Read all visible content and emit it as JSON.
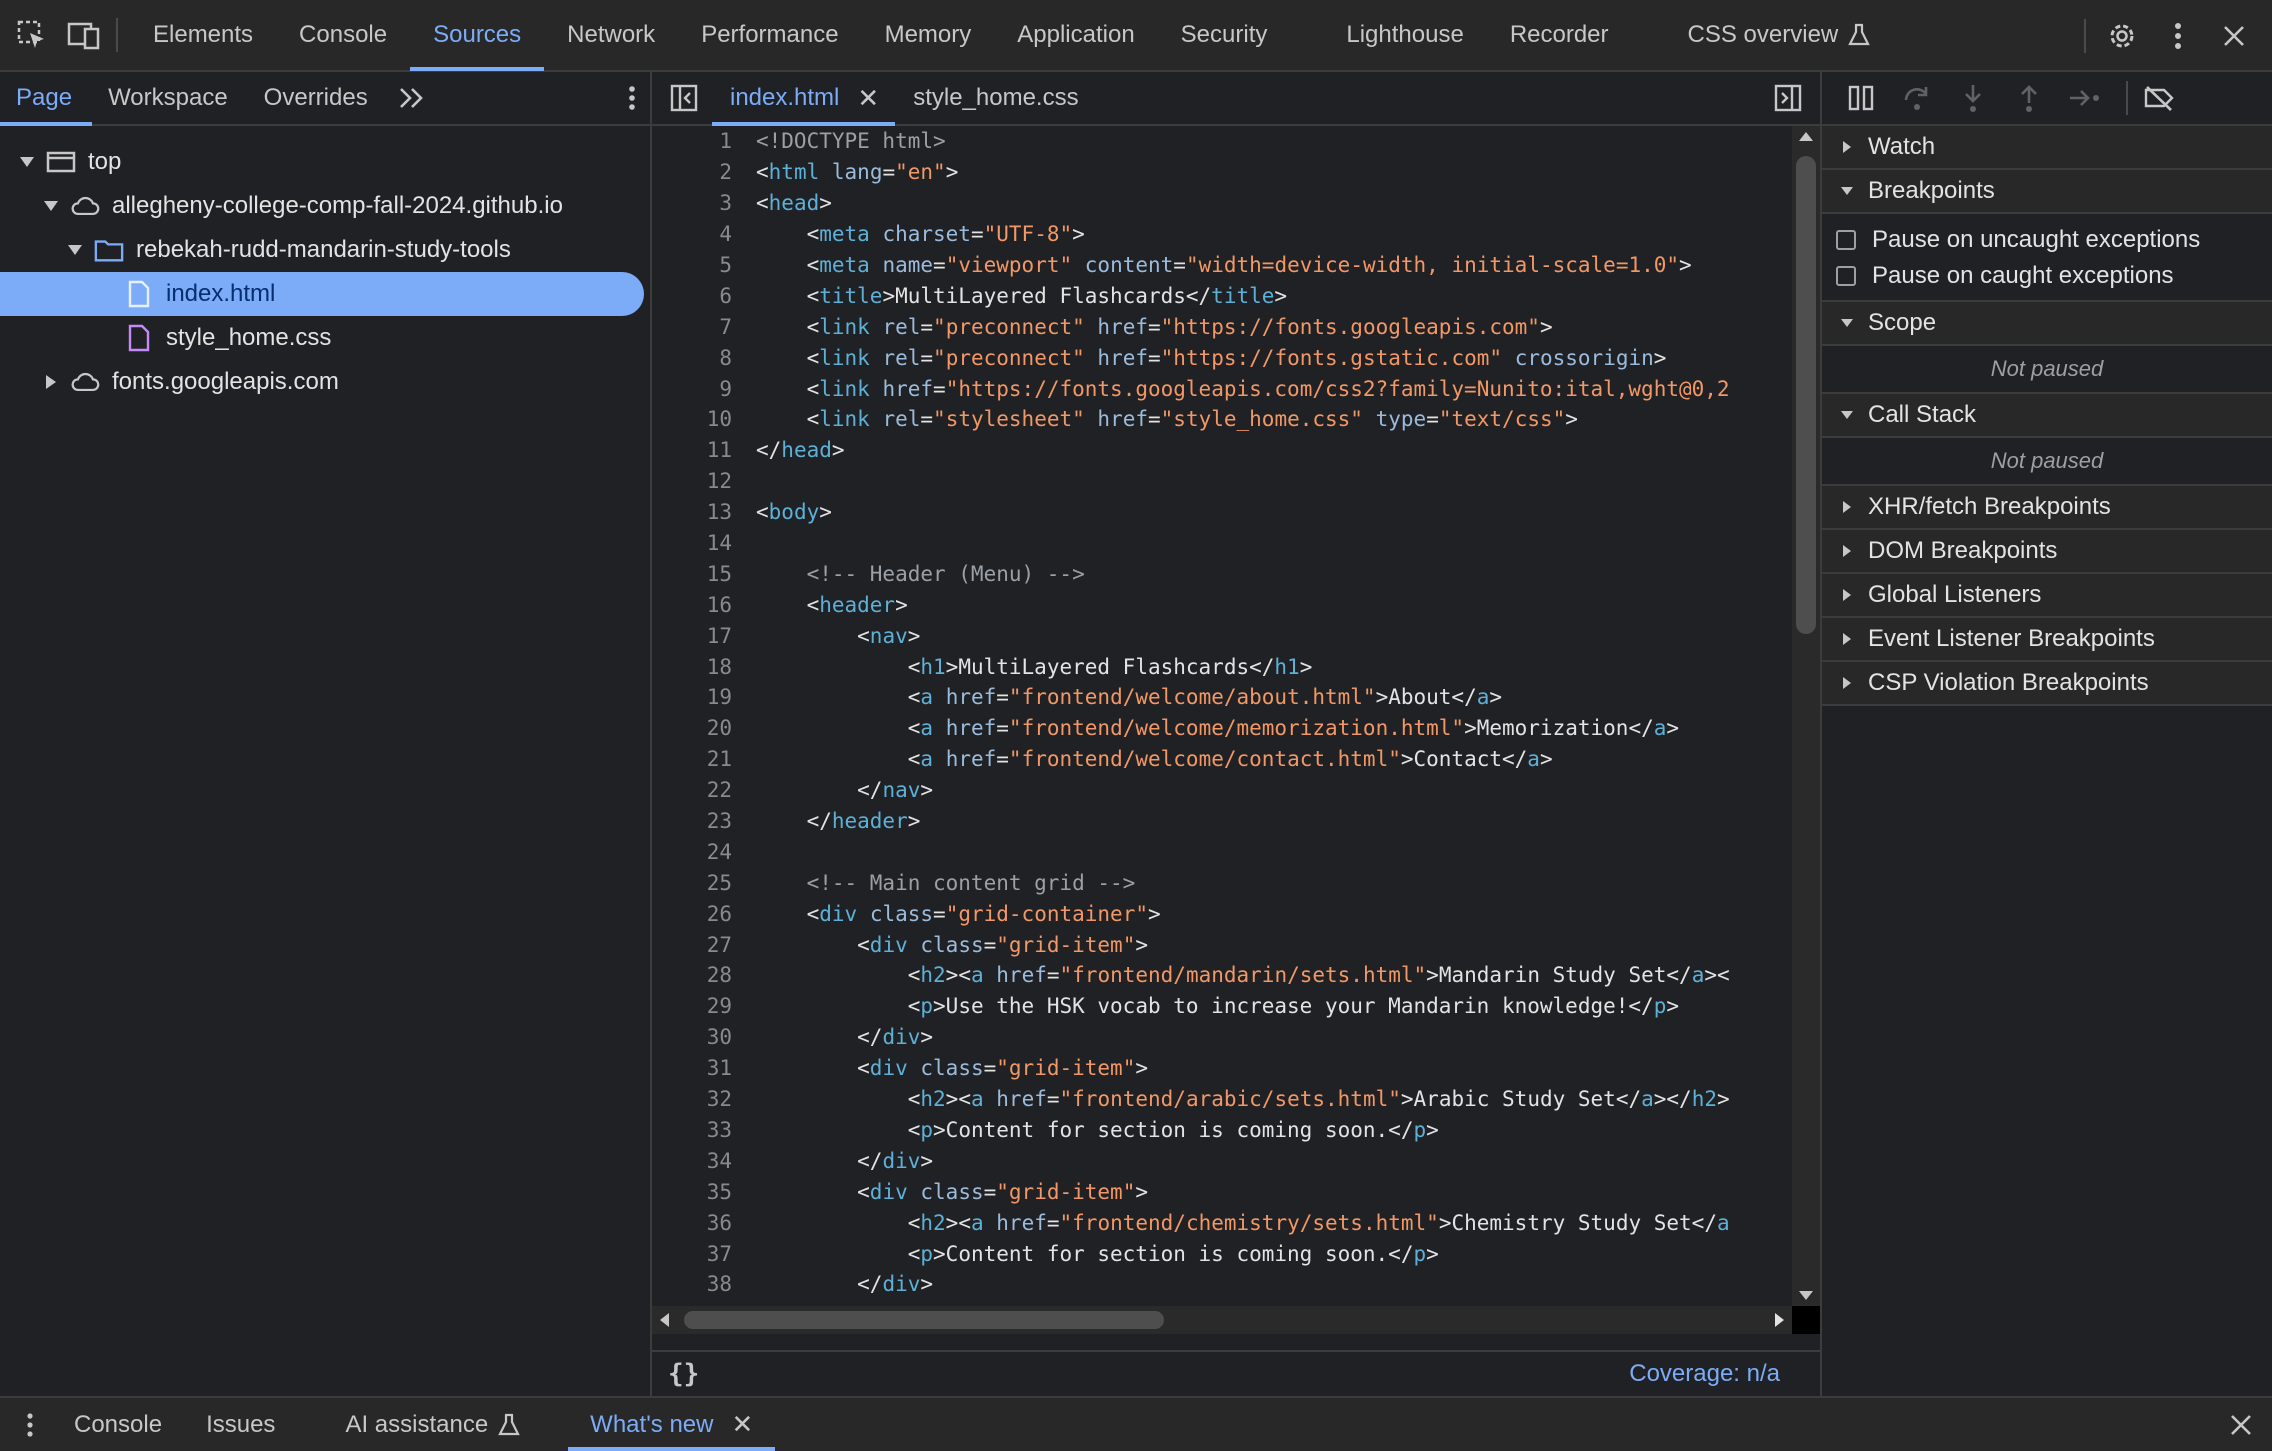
{
  "toolbar": {
    "tabs": [
      {
        "label": "Elements"
      },
      {
        "label": "Console"
      },
      {
        "label": "Sources"
      },
      {
        "label": "Network"
      },
      {
        "label": "Performance"
      },
      {
        "label": "Memory"
      },
      {
        "label": "Application"
      },
      {
        "label": "Security"
      },
      {
        "label": "Lighthouse"
      },
      {
        "label": "Recorder"
      },
      {
        "label": "CSS overview"
      }
    ],
    "active_tab": "Sources",
    "accent": "#7cacf8"
  },
  "navigator": {
    "subtabs": [
      {
        "label": "Page"
      },
      {
        "label": "Workspace"
      },
      {
        "label": "Overrides"
      }
    ],
    "tree": [
      {
        "label": "top"
      },
      {
        "label": "allegheny-college-comp-fall-2024.github.io"
      },
      {
        "label": "rebekah-rudd-mandarin-study-tools"
      },
      {
        "label": "index.html"
      },
      {
        "label": "style_home.css"
      },
      {
        "label": "fonts.googleapis.com"
      }
    ]
  },
  "editor": {
    "tabs": [
      {
        "label": "index.html"
      },
      {
        "label": "style_home.css"
      }
    ],
    "coverage": "Coverage: n/a",
    "lines": [
      {
        "n": "1",
        "text": "<!DOCTYPE html>"
      },
      {
        "n": "2",
        "text": "<html lang=\"en\">"
      },
      {
        "n": "3",
        "text": "<head>"
      },
      {
        "n": "4",
        "text": "    <meta charset=\"UTF-8\">"
      },
      {
        "n": "5",
        "text": "    <meta name=\"viewport\" content=\"width=device-width, initial-scale=1.0\">"
      },
      {
        "n": "6",
        "text": "    <title>MultiLayered Flashcards</title>"
      },
      {
        "n": "7",
        "text": "    <link rel=\"preconnect\" href=\"https://fonts.googleapis.com\">"
      },
      {
        "n": "8",
        "text": "    <link rel=\"preconnect\" href=\"https://fonts.gstatic.com\" crossorigin>"
      },
      {
        "n": "9",
        "text": "    <link href=\"https://fonts.googleapis.com/css2?family=Nunito:ital,wght@0,2"
      },
      {
        "n": "10",
        "text": "    <link rel=\"stylesheet\" href=\"style_home.css\" type=\"text/css\">"
      },
      {
        "n": "11",
        "text": "</head>"
      },
      {
        "n": "12",
        "text": ""
      },
      {
        "n": "13",
        "text": "<body>"
      },
      {
        "n": "14",
        "text": ""
      },
      {
        "n": "15",
        "text": "    <!-- Header (Menu) -->"
      },
      {
        "n": "16",
        "text": "    <header>"
      },
      {
        "n": "17",
        "text": "        <nav>"
      },
      {
        "n": "18",
        "text": "            <h1>MultiLayered Flashcards</h1>"
      },
      {
        "n": "19",
        "text": "            <a href=\"frontend/welcome/about.html\">About</a>"
      },
      {
        "n": "20",
        "text": "            <a href=\"frontend/welcome/memorization.html\">Memorization</a>"
      },
      {
        "n": "21",
        "text": "            <a href=\"frontend/welcome/contact.html\">Contact</a>"
      },
      {
        "n": "22",
        "text": "        </nav>"
      },
      {
        "n": "23",
        "text": "    </header>"
      },
      {
        "n": "24",
        "text": ""
      },
      {
        "n": "25",
        "text": "    <!-- Main content grid -->"
      },
      {
        "n": "26",
        "text": "    <div class=\"grid-container\">"
      },
      {
        "n": "27",
        "text": "        <div class=\"grid-item\">"
      },
      {
        "n": "28",
        "text": "            <h2><a href=\"frontend/mandarin/sets.html\">Mandarin Study Set</a><"
      },
      {
        "n": "29",
        "text": "            <p>Use the HSK vocab to increase your Mandarin knowledge!</p>"
      },
      {
        "n": "30",
        "text": "        </div>"
      },
      {
        "n": "31",
        "text": "        <div class=\"grid-item\">"
      },
      {
        "n": "32",
        "text": "            <h2><a href=\"frontend/arabic/sets.html\">Arabic Study Set</a></h2>"
      },
      {
        "n": "33",
        "text": "            <p>Content for section is coming soon.</p>"
      },
      {
        "n": "34",
        "text": "        </div>"
      },
      {
        "n": "35",
        "text": "        <div class=\"grid-item\">"
      },
      {
        "n": "36",
        "text": "            <h2><a href=\"frontend/chemistry/sets.html\">Chemistry Study Set</a"
      },
      {
        "n": "37",
        "text": "            <p>Content for section is coming soon.</p>"
      },
      {
        "n": "38",
        "text": "        </div>"
      }
    ]
  },
  "debugger": {
    "sections": {
      "watch": "Watch",
      "breakpoints": "Breakpoints",
      "pause_uncaught": "Pause on uncaught exceptions",
      "pause_caught": "Pause on caught exceptions",
      "scope": "Scope",
      "not_paused_1": "Not paused",
      "call_stack": "Call Stack",
      "not_paused_2": "Not paused",
      "xhr": "XHR/fetch Breakpoints",
      "dom": "DOM Breakpoints",
      "global": "Global Listeners",
      "event": "Event Listener Breakpoints",
      "csp": "CSP Violation Breakpoints"
    }
  },
  "drawer": {
    "tabs": [
      {
        "label": "Console"
      },
      {
        "label": "Issues"
      },
      {
        "label": "AI assistance"
      },
      {
        "label": "What's new"
      }
    ]
  }
}
